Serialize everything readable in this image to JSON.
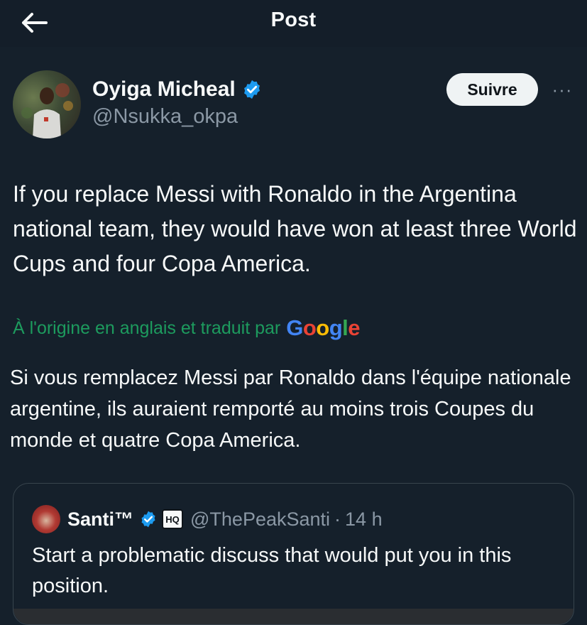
{
  "header": {
    "title": "Post",
    "back_icon": "arrow-left-icon"
  },
  "author": {
    "name": "Oyiga Micheal",
    "handle": "@Nsukka_okpa",
    "verified_color": "#1d9bf0"
  },
  "actions": {
    "follow_label": "Suivre",
    "more_label": "···"
  },
  "tweet": {
    "text": "If you replace Messi with Ronaldo in the Argentina national team, they would have won at least three World Cups and four Copa America."
  },
  "translation": {
    "label": "À l'origine en anglais et traduit par",
    "provider_letters": [
      "G",
      "o",
      "o",
      "g",
      "l",
      "e"
    ],
    "provider_colors": [
      "#4285f4",
      "#ea4335",
      "#fbbc05",
      "#4285f4",
      "#34a853",
      "#ea4335"
    ],
    "text": "Si vous remplacez Messi par Ronaldo dans l'équipe nationale argentine, ils auraient remporté au moins trois Coupes du monde et quatre Copa America."
  },
  "quoted": {
    "name": "Santi™",
    "badge_label": "HQ",
    "handle": "@ThePeakSanti",
    "separator": "·",
    "time": "14 h",
    "text": "Start a problematic discuss that would put you in this position."
  },
  "colors": {
    "background": "#15202b",
    "text": "#f7f9f9",
    "muted": "#8b98a5",
    "translate_green": "#1d9b5e",
    "verified_blue": "#1d9bf0"
  }
}
